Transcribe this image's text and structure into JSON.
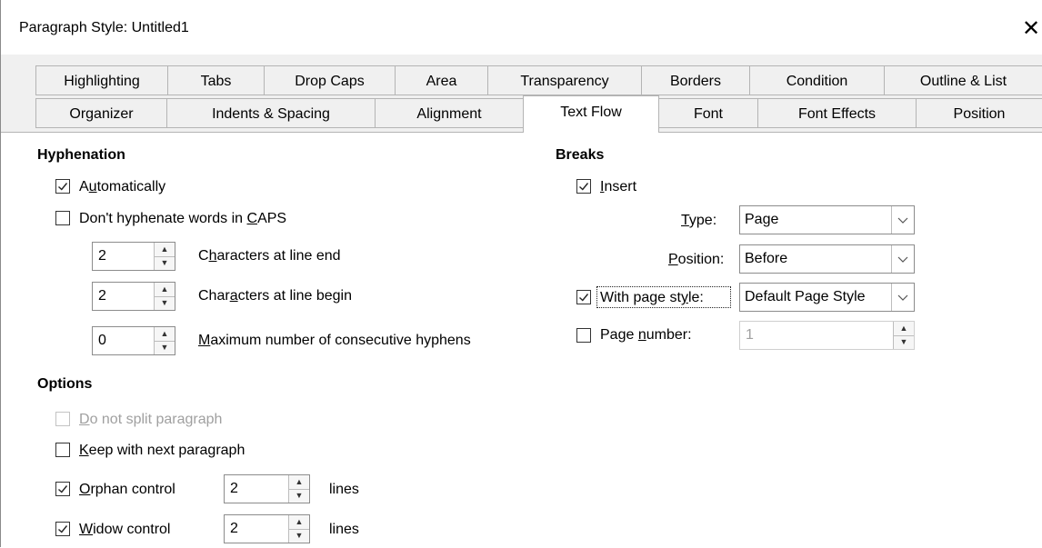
{
  "window": {
    "title": "Paragraph Style: Untitled1"
  },
  "tabs_row1": [
    "Highlighting",
    "Tabs",
    "Drop Caps",
    "Area",
    "Transparency",
    "Borders",
    "Condition",
    "Outline & List"
  ],
  "tabs_row2": [
    "Organizer",
    "Indents & Spacing",
    "Alignment",
    "Text Flow",
    "Font",
    "Font Effects",
    "Position"
  ],
  "active_tab": "Text Flow",
  "hyphenation": {
    "heading": "Hyphenation",
    "automatically": {
      "pre": "A",
      "u": "u",
      "post": "tomatically",
      "checked": true
    },
    "caps": {
      "pre": "Don't hyphenate words in ",
      "u": "C",
      "post": "APS",
      "checked": false
    },
    "line_end": {
      "value": "2",
      "pre": "C",
      "u": "h",
      "post": "aracters at line end"
    },
    "line_begin": {
      "value": "2",
      "pre": "Char",
      "u": "a",
      "post": "cters at line begin"
    },
    "max_hyphens": {
      "value": "0",
      "pre": "",
      "u": "M",
      "post": "aximum number of consecutive hyphens"
    }
  },
  "options": {
    "heading": "Options",
    "no_split": {
      "pre": "",
      "u": "D",
      "post": "o not split paragraph",
      "checked": false,
      "disabled": true
    },
    "keep_next": {
      "pre": "",
      "u": "K",
      "post": "eep with next paragraph",
      "checked": false
    },
    "orphan": {
      "pre": "",
      "u": "O",
      "post": "rphan control",
      "checked": true,
      "value": "2",
      "unit": "lines"
    },
    "widow": {
      "pre": "",
      "u": "W",
      "post": "idow control",
      "checked": true,
      "value": "2",
      "unit": "lines"
    }
  },
  "breaks": {
    "heading": "Breaks",
    "insert": {
      "pre": "",
      "u": "I",
      "post": "nsert",
      "checked": true
    },
    "type": {
      "pre": "",
      "u": "T",
      "post": "ype:",
      "value": "Page"
    },
    "position": {
      "pre": "",
      "u": "P",
      "post": "osition:",
      "value": "Before"
    },
    "page_style": {
      "pre": "With page st",
      "u": "y",
      "post": "le:",
      "checked": true,
      "value": "Default Page Style"
    },
    "page_number": {
      "pre": "Page ",
      "u": "n",
      "post": "umber:",
      "checked": false,
      "value": "1"
    }
  }
}
